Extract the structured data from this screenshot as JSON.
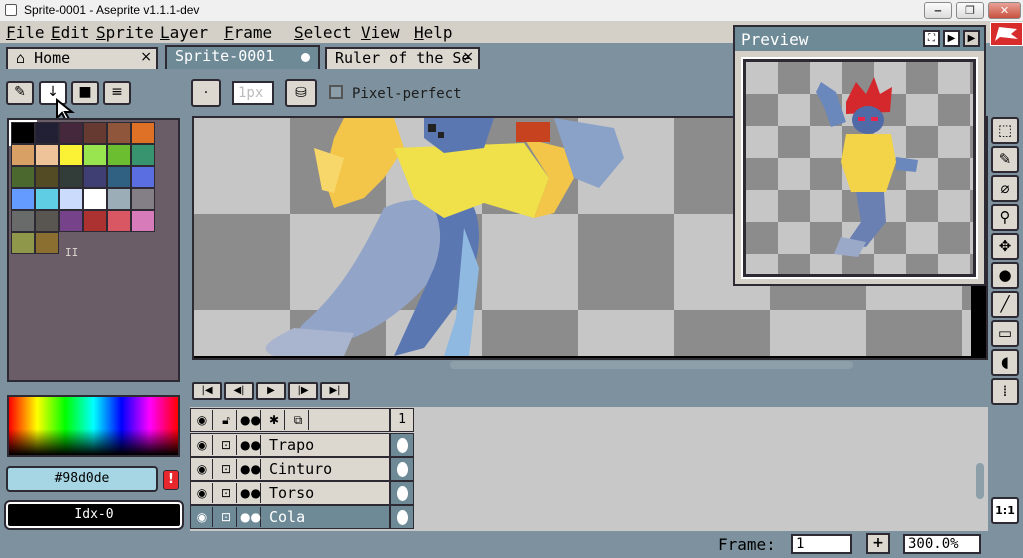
{
  "window": {
    "title": "Sprite-0001 - Aseprite v1.1.1-dev",
    "controls": [
      "minimize-icon",
      "restore-icon",
      "close-icon"
    ]
  },
  "menubar": {
    "items": [
      {
        "label": "File",
        "u": "F",
        "rest": "ile"
      },
      {
        "label": "Edit",
        "u": "E",
        "rest": "dit"
      },
      {
        "label": "Sprite",
        "u": "S",
        "rest": "prite"
      },
      {
        "label": "Layer",
        "u": "L",
        "rest": "ayer"
      },
      {
        "label": "Frame",
        "u": "F",
        "rest": "rame"
      },
      {
        "label": "Select",
        "u": "S",
        "rest": "elect"
      },
      {
        "label": "View",
        "u": "V",
        "rest": "iew"
      },
      {
        "label": "Help",
        "u": "H",
        "rest": "elp"
      }
    ]
  },
  "tabs": [
    {
      "label": "Home",
      "icon": "home-icon",
      "close": "×"
    },
    {
      "label": "Sprite-0001",
      "active": true
    },
    {
      "label": "Ruler of the Se",
      "close": "×"
    }
  ],
  "palette_toolbar": {
    "buttons": [
      "✎",
      "↓",
      "■",
      "≡"
    ]
  },
  "palette": {
    "colors": [
      "#000000",
      "#222034",
      "#45283c",
      "#663931",
      "#8f563b",
      "#df7126",
      "#d9a066",
      "#eec39a",
      "#fbf236",
      "#99e550",
      "#6abe30",
      "#37946e",
      "#4b692f",
      "#524b24",
      "#323c39",
      "#3f3f74",
      "#306082",
      "#5b6ee1",
      "#639bff",
      "#5fcde4",
      "#cbdbfc",
      "#ffffff",
      "#9badb7",
      "#847e87",
      "#696a6a",
      "#595652",
      "#76428a",
      "#ac3232",
      "#d95763",
      "#d77bba",
      "#8f974a",
      "#8a6f30"
    ],
    "more": "II"
  },
  "color_bar": {
    "hex": "#98d0de",
    "warning": "!",
    "index": "Idx-0"
  },
  "context_bar": {
    "brush_type": "·",
    "brush_size": "1px",
    "ink": "⛁",
    "pixel_perfect_label": "Pixel-perfect",
    "pixel_perfect_checked": false
  },
  "preview": {
    "title": "Preview",
    "buttons": [
      "⛶",
      "▶",
      "▶"
    ]
  },
  "tools": [
    {
      "name": "rectangular-marquee-icon",
      "glyph": "⬚"
    },
    {
      "name": "pencil-icon",
      "glyph": "✎"
    },
    {
      "name": "eyedropper-icon",
      "glyph": "⌀"
    },
    {
      "name": "zoom-icon",
      "glyph": "⚲"
    },
    {
      "name": "move-icon",
      "glyph": "✥"
    },
    {
      "name": "paint-bucket-icon",
      "glyph": "●"
    },
    {
      "name": "line-icon",
      "glyph": "╱"
    },
    {
      "name": "rectangle-icon",
      "glyph": "▭"
    },
    {
      "name": "blur-icon",
      "glyph": "◖"
    },
    {
      "name": "spray-icon",
      "glyph": "⁞"
    }
  ],
  "timeline": {
    "controls": [
      "|◀",
      "◀|",
      "▶",
      "|▶",
      "▶|"
    ],
    "header": {
      "frame": "1"
    },
    "layers": [
      {
        "name": "Trapo",
        "selected": false
      },
      {
        "name": "Cinturo",
        "selected": false
      },
      {
        "name": "Torso",
        "selected": false
      },
      {
        "name": "Cola",
        "selected": true
      }
    ]
  },
  "status": {
    "frame_label": "Frame:",
    "frame_value": "1",
    "plus": "+",
    "zoom": "300.0%",
    "one_to_one": "1:1"
  },
  "accent": {
    "panel": "#6e8a97",
    "workspace": "#7d929e",
    "dark": "#2d2a33",
    "red": "#d82b2b"
  }
}
